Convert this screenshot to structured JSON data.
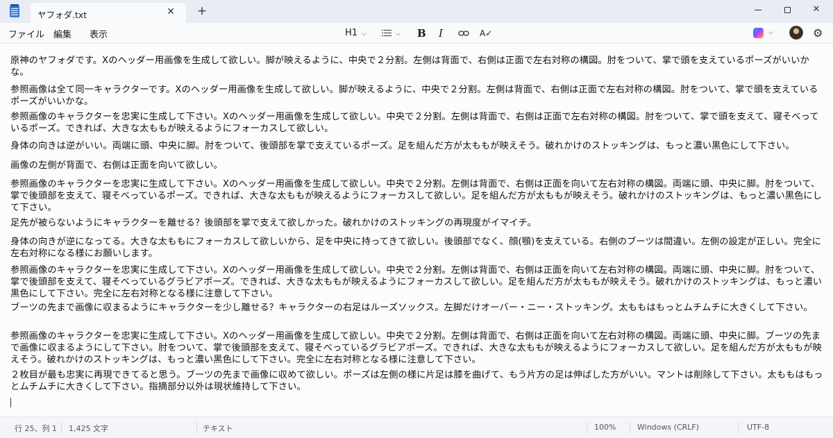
{
  "tab": {
    "title": "ヤフォダ.txt",
    "close_icon": "close-icon",
    "new_tab": "+"
  },
  "window": {
    "minimize": "",
    "maximize": "",
    "close": "✕"
  },
  "menu": {
    "file": "ファイル",
    "edit": "編集",
    "view": "表示"
  },
  "toolbar": {
    "heading": "H1",
    "bold": "B",
    "italic": "I",
    "link_icon": "⊖",
    "spellcheck": "A✓",
    "settings_icon": "⚙"
  },
  "editor": {
    "paragraphs": [
      "原神のヤフォダです。Xのヘッダー用画像を生成して欲しい。脚が映えるように、中央で２分割。左側は背面で、右側は正面で左右対称の構図。肘をついて、掌で頭を支えているポーズがいいかな。",
      "参照画像は全て同一キャラクターです。Xのヘッダー用画像を生成して欲しい。脚が映えるように、中央で２分割。左側は背面で、右側は正面で左右対称の構図。肘をついて、掌で頭を支えているポーズがいいかな。",
      "参照画像のキャラクターを忠実に生成して下さい。Xのヘッダー用画像を生成して欲しい。中央で２分割。左側は背面で、右側は正面で左右対称の構図。肘をついて、掌で頭を支えて、寝そべっているポーズ。できれば、大きな太ももが映えるようにフォーカスして欲しい。",
      "身体の向きは逆がいい。両端に頭、中央に脚。肘をついて、後頭部を掌で支えているポーズ。足を組んだ方が太ももが映えそう。破れかけのストッキングは、もっと濃い黒色にして下さい。",
      "画像の左側が背面で、右側は正面を向いて欲しい。",
      "参照画像のキャラクターを忠実に生成して下さい。Xのヘッダー用画像を生成して欲しい。中央で２分割。左側は背面で、右側は正面を向いて左右対称の構図。両端に頭、中央に脚。肘をついて、掌で後頭部を支えて、寝そべっているポーズ。できれば、大きな太ももが映えるようにフォーカスして欲しい。足を組んだ方が太ももが映えそう。破れかけのストッキングは、もっと濃い黒色にして下さい。",
      "足先が被らないようにキャラクターを離せる？後頭部を掌で支えて欲しかった。破れかけのストッキングの再現度がイマイチ。",
      "身体の向きが逆になってる。大きな太ももにフォーカスして欲しいから、足を中央に持ってきて欲しい。後頭部でなく、顔(顎)を支えている。右側のブーツは間違い。左側の設定が正しい。完全に左右対称になる様にお願いします。",
      "参照画像のキャラクターを忠実に生成して下さい。Xのヘッダー用画像を生成して欲しい。中央で２分割。左側は背面で、右側は正面を向いて左右対称の構図。両端に頭、中央に脚。肘をついて、掌で後頭部を支えて、寝そべっているグラビアポーズ。できれば、大きな太ももが映えるようにフォーカスして欲しい。足を組んだ方が太ももが映えそう。破れかけのストッキングは、もっと濃い黒色にして下さい。完全に左右対称となる様に注意して下さい。",
      "ブーツの先まで画像に収まるようにキャラクターを少し離せる？キャラクターの右足はルーズソックス。左脚だけオーバー・ニー・ストッキング。太ももはもっとムチムチに大きくして下さい。",
      "参照画像のキャラクターを忠実に生成して下さい。Xのヘッダー用画像を生成して欲しい。中央で２分割。左側は背面で、右側は正面を向いて左右対称の構図。両端に頭、中央に脚。ブーツの先まで画像に収まるようにして下さい。肘をついて、掌で後頭部を支えて、寝そべっているグラビアポーズ。できれば、大きな太ももが映えるようにフォーカスして欲しい。足を組んだ方が太ももが映えそう。破れかけのストッキングは、もっと濃い黒色にして下さい。完全に左右対称となる様に注意して下さい。",
      "２枚目が最も忠実に再現できてると思う。ブーツの先まで画像に収めて欲しい。ポーズは左側の様に片足は膝を曲げて、もう片方の足は伸ばした方がいい。マントは削除して下さい。太ももはもっとムチムチに大きくして下さい。指摘部分以外は現状維持して下さい。"
    ]
  },
  "status": {
    "position": "行 25、列 1",
    "char_count": "1,425 文字",
    "format": "テキスト",
    "zoom": "100%",
    "line_ending": "Windows (CRLF)",
    "encoding": "UTF-8"
  }
}
